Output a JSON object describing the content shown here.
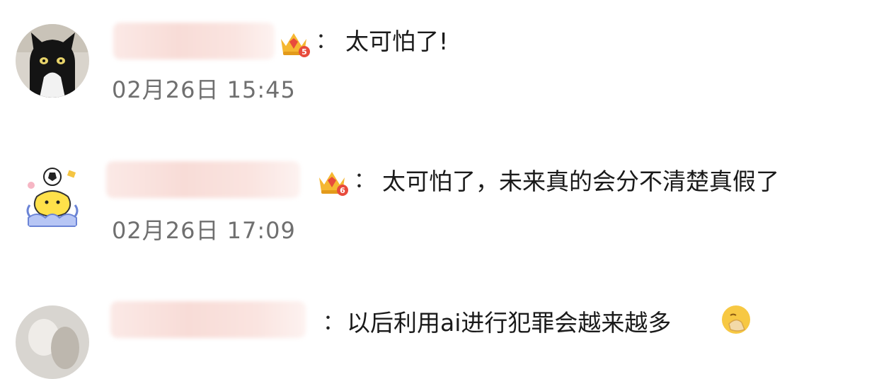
{
  "comments": [
    {
      "avatar_icon": "black-cat-avatar-icon",
      "badge_icon": "crown-level-icon",
      "badge_level": "5",
      "separator": "：",
      "text": "太可怕了!",
      "time": "02月26日 15:45"
    },
    {
      "avatar_icon": "cartoon-soccer-avatar-icon",
      "badge_icon": "crown-level-icon",
      "badge_level": "6",
      "separator": "：",
      "text": "太可怕了，未来真的会分不清楚真假了",
      "time": "02月26日 17:09"
    },
    {
      "avatar_icon": "photo-avatar-icon",
      "separator": "：",
      "text": "以后利用ai进行犯罪会越来越多",
      "trailing_emoji": "facepalm-emoji-icon"
    }
  ],
  "colors": {
    "crown_gold": "#f5b731",
    "crown_red": "#e84b3c",
    "time_gray": "#6f6f6f",
    "text_dark": "#1a1a1a"
  }
}
